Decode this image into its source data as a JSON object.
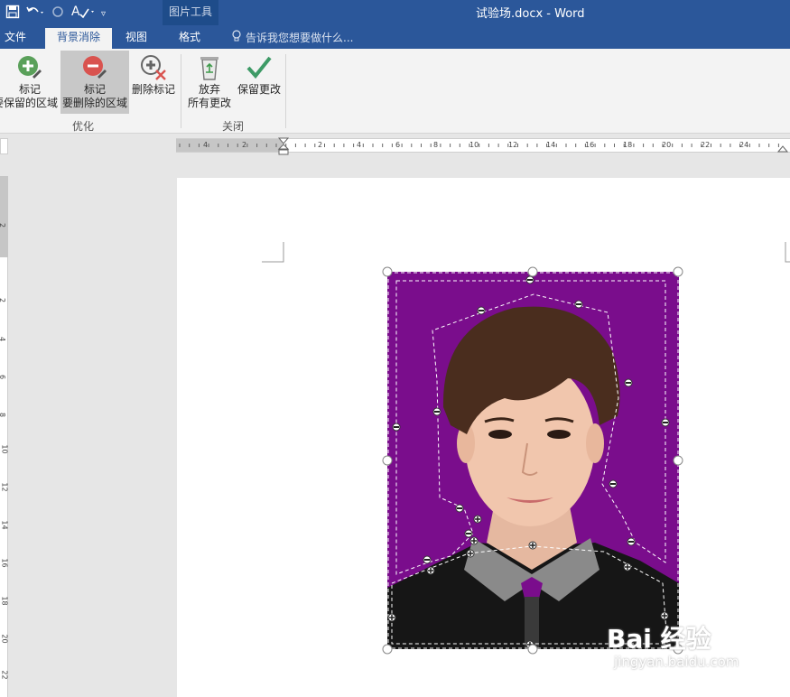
{
  "window": {
    "doc_title": "试验场.docx - Word",
    "context_tab_group": "图片工具"
  },
  "qat": {
    "save_icon": "save-icon",
    "undo_icon": "undo-icon",
    "redo_icon": "redo-icon",
    "spell_icon": "spellcheck-icon"
  },
  "tabs": [
    {
      "label": "文件"
    },
    {
      "label": "背景消除"
    },
    {
      "label": "视图"
    },
    {
      "label": "格式"
    }
  ],
  "tell_me": "告诉我您想要做什么...",
  "ribbon": {
    "mark_keep_line1": "标记",
    "mark_keep_line2": "要保留的区域",
    "mark_remove_line1": "标记",
    "mark_remove_line2": "要删除的区域",
    "delete_mark": "删除标记",
    "discard_line1": "放弃",
    "discard_line2": "所有更改",
    "keep_changes": "保留更改",
    "group_refine": "优化",
    "group_close": "关闭"
  },
  "ruler_h_numbers": [
    "4",
    "2",
    "2",
    "4",
    "6",
    "8",
    "10",
    "12",
    "14",
    "16",
    "18",
    "20",
    "22",
    "24"
  ],
  "ruler_v_numbers": [
    "2",
    "2",
    "4",
    "6",
    "8",
    "10",
    "12",
    "14",
    "16",
    "18",
    "20",
    "22"
  ],
  "colors": {
    "accent": "#2b579a",
    "removed_area": "#7a0d8c"
  },
  "watermark": {
    "big": "Bai 经验",
    "small": "jingyan.baidu.com"
  }
}
